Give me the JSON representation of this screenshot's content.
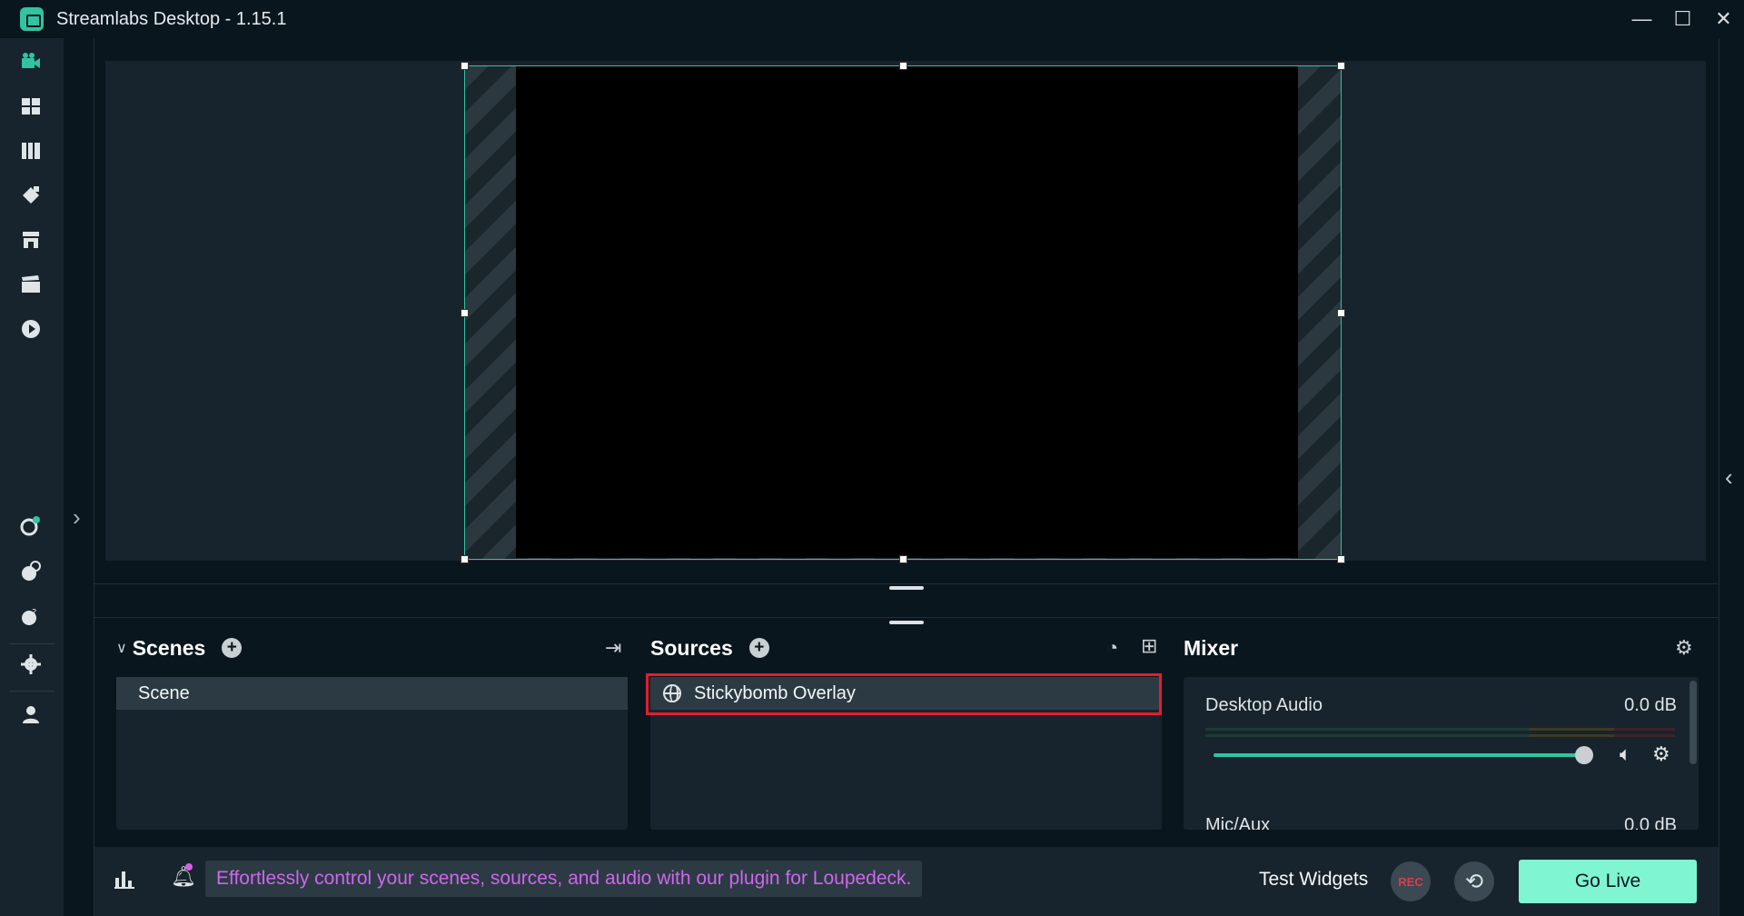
{
  "window": {
    "title": "Streamlabs Desktop - 1.15.1",
    "controls": {
      "minimize": "—",
      "maximize": "☐",
      "close": "✕"
    }
  },
  "leftnav": {
    "items": [
      {
        "name": "editor",
        "icon": "video-camera-icon",
        "active": true
      },
      {
        "name": "layout",
        "icon": "layout-grid-icon"
      },
      {
        "name": "studio-mode",
        "icon": "columns-icon"
      },
      {
        "name": "themes",
        "icon": "paint-palette-icon"
      },
      {
        "name": "app-store",
        "icon": "store-icon"
      },
      {
        "name": "highlighter",
        "icon": "clapperboard-icon"
      },
      {
        "name": "recordings",
        "icon": "play-circle-icon"
      }
    ],
    "bottom_items": [
      {
        "name": "dashboard",
        "icon": "dashboard-icon"
      },
      {
        "name": "chat",
        "icon": "chat-icon"
      },
      {
        "name": "help",
        "icon": "help-icon"
      },
      {
        "name": "settings",
        "icon": "gear-icon"
      },
      {
        "name": "profile",
        "icon": "user-icon"
      }
    ]
  },
  "scenes": {
    "title": "Scenes",
    "items": [
      "Scene"
    ]
  },
  "sources": {
    "title": "Sources",
    "items": [
      "Stickybomb Overlay"
    ]
  },
  "mixer": {
    "title": "Mixer",
    "channels": [
      {
        "name": "Desktop Audio",
        "db": "0.0 dB",
        "volume_fraction": 1.0
      },
      {
        "name": "Mic/Aux",
        "db": "0.0 dB"
      }
    ]
  },
  "footer": {
    "promo": "Effortlessly control your scenes, sources, and audio with our plugin for Loupedeck.",
    "test_widgets": "Test Widgets",
    "rec": "REC",
    "go_live": "Go Live"
  },
  "colors": {
    "accent": "#31c3a2",
    "go_live": "#80f5d2",
    "promo_text": "#cf65f0",
    "highlight": "#e31d2f"
  }
}
